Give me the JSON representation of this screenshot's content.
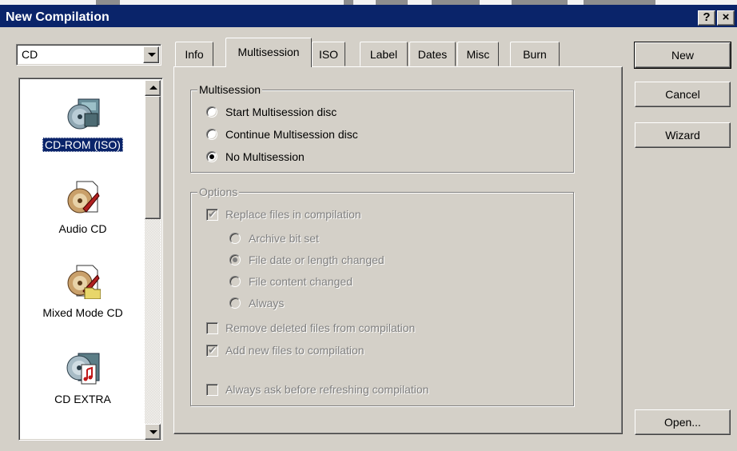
{
  "window": {
    "title": "New Compilation",
    "help_button": "?",
    "close_button": "×"
  },
  "compilation_type": {
    "selected": "CD"
  },
  "list": {
    "items": [
      {
        "label": "CD-ROM (ISO)",
        "icon": "cd-rom-iso-icon",
        "selected": true
      },
      {
        "label": "Audio CD",
        "icon": "audio-cd-icon",
        "selected": false
      },
      {
        "label": "Mixed Mode CD",
        "icon": "mixed-mode-cd-icon",
        "selected": false
      },
      {
        "label": "CD EXTRA",
        "icon": "cd-extra-icon",
        "selected": false
      }
    ]
  },
  "tabs": [
    {
      "label": "Info",
      "active": false
    },
    {
      "label": "Multisession",
      "active": true
    },
    {
      "label": "ISO",
      "active": false
    },
    {
      "label": "Label",
      "active": false
    },
    {
      "label": "Dates",
      "active": false
    },
    {
      "label": "Misc",
      "active": false
    },
    {
      "label": "Burn",
      "active": false
    }
  ],
  "multisession": {
    "title": "Multisession",
    "options": [
      {
        "label": "Start Multisession disc",
        "checked": false
      },
      {
        "label": "Continue Multisession disc",
        "checked": false
      },
      {
        "label": "No Multisession",
        "checked": true
      }
    ]
  },
  "options": {
    "title": "Options",
    "replace_files": {
      "label": "Replace files in compilation",
      "checked": true
    },
    "replace_modes": [
      {
        "label": "Archive bit set",
        "checked": false
      },
      {
        "label": "File date or length changed",
        "checked": true
      },
      {
        "label": "File content changed",
        "checked": false
      },
      {
        "label": "Always",
        "checked": false
      }
    ],
    "remove_deleted": {
      "label": "Remove deleted files from compilation",
      "checked": false
    },
    "add_new": {
      "label": "Add new files to compilation",
      "checked": true
    },
    "always_ask": {
      "label": "Always ask before refreshing compilation",
      "checked": false
    }
  },
  "buttons": {
    "new": "New",
    "cancel": "Cancel",
    "wizard": "Wizard",
    "open": "Open..."
  },
  "colors": {
    "titlebar": "#0a246a",
    "face": "#d4d0c8",
    "selection": "#0a246a"
  }
}
